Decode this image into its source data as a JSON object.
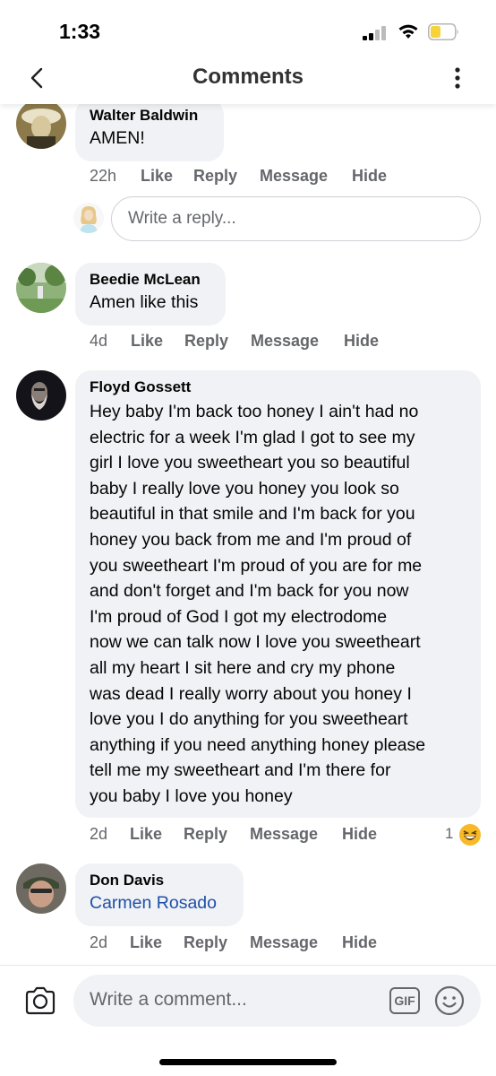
{
  "status_bar": {
    "time": "1:33"
  },
  "header": {
    "title": "Comments"
  },
  "comments": [
    {
      "author": "Walter Baldwin",
      "text": "AMEN!",
      "time": "22h",
      "actions": {
        "like": "Like",
        "reply": "Reply",
        "message": "Message",
        "hide": "Hide"
      }
    },
    {
      "author": "Beedie McLean",
      "text": "Amen like this",
      "time": "4d",
      "actions": {
        "like": "Like",
        "reply": "Reply",
        "message": "Message",
        "hide": "Hide"
      }
    },
    {
      "author": "Floyd Gossett",
      "text_lines": [
        "Hey baby I'm back too honey I ain't had no",
        "electric for a week I'm glad I got to see my",
        "girl I love you sweetheart you so beautiful",
        "baby I really love you honey you look so",
        "beautiful in that smile and I'm back for you",
        "honey you back from me and I'm proud of",
        "you sweetheart I'm proud of you are for me",
        "and don't forget and I'm back for you now",
        "I'm proud of God I got my electrodome",
        "now we can talk now I love you sweetheart",
        "all my heart I sit here and cry my phone",
        "was dead I really worry about you honey I",
        "love you I do anything for you sweetheart",
        "anything if you need anything honey please",
        "tell me my sweetheart and I'm there for",
        "you baby I love you honey"
      ],
      "time": "2d",
      "reaction_count": "1",
      "reaction_icon": "laughing-emoji-icon",
      "actions": {
        "like": "Like",
        "reply": "Reply",
        "message": "Message",
        "hide": "Hide"
      }
    },
    {
      "author": "Don Davis",
      "mention": "Carmen Rosado",
      "time": "2d",
      "actions": {
        "like": "Like",
        "reply": "Reply",
        "message": "Message",
        "hide": "Hide"
      }
    }
  ],
  "reply_box": {
    "placeholder": "Write a reply..."
  },
  "composer": {
    "placeholder": "Write a comment...",
    "gif_label": "GIF"
  },
  "colors": {
    "bubble": "#f0f2f5",
    "secondary_text": "#65676b",
    "mention_link": "#1f4fa8",
    "battery_low": "#f5d33b",
    "reaction_emoji": "#f7b928"
  }
}
